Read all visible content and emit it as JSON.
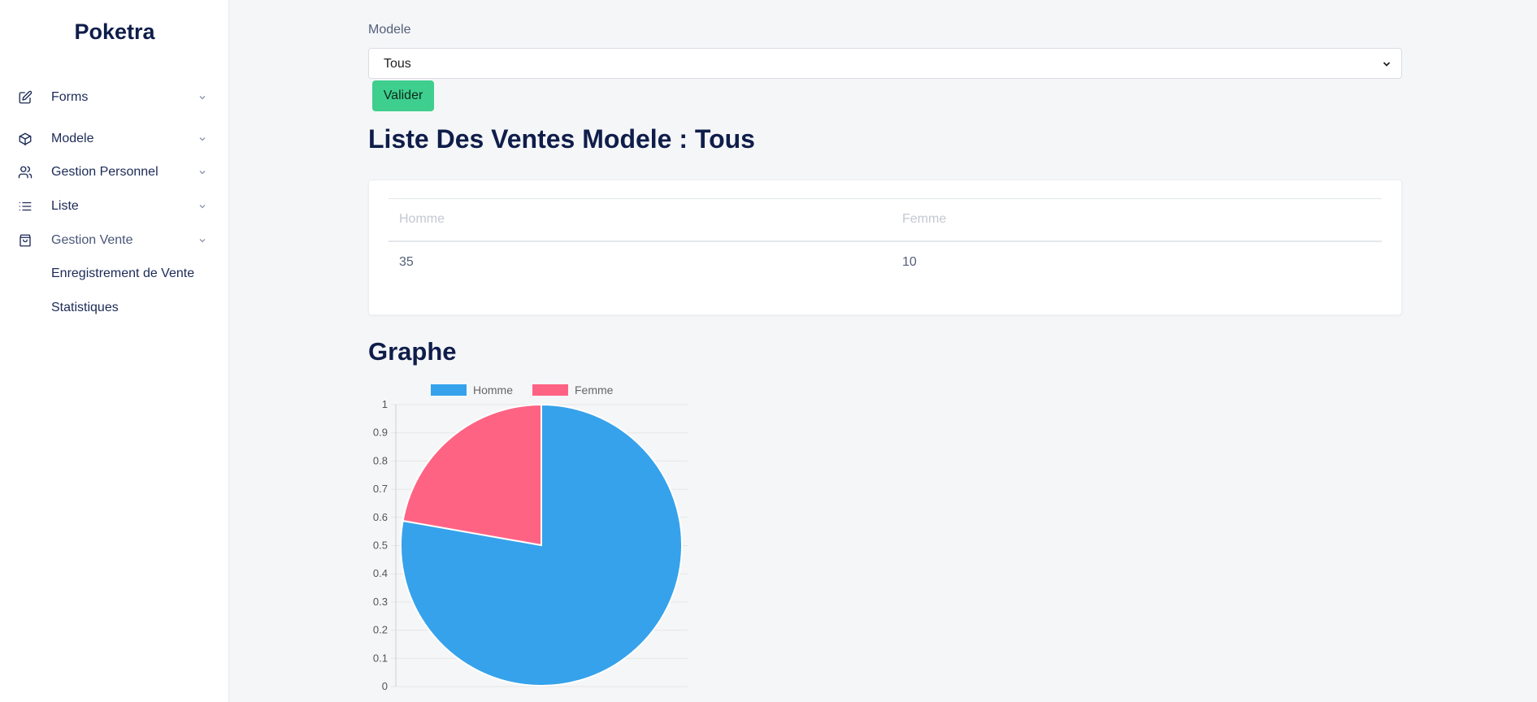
{
  "sidebar": {
    "brand": "Poketra",
    "items": [
      {
        "label": "Forms",
        "icon": "edit-icon"
      },
      {
        "label": "Modele",
        "icon": "box-icon"
      },
      {
        "label": "Gestion Personnel",
        "icon": "users-icon"
      },
      {
        "label": "Liste",
        "icon": "list-icon"
      },
      {
        "label": "Gestion Vente",
        "icon": "shopping-bag-icon"
      }
    ],
    "sub_items": [
      {
        "label": "Enregistrement de Vente"
      },
      {
        "label": "Statistiques"
      }
    ]
  },
  "filter": {
    "label": "Modele",
    "selected": "Tous",
    "button_label": "Valider"
  },
  "page_title": "Liste Des Ventes Modele : Tous",
  "table": {
    "headers": [
      "Homme",
      "Femme"
    ],
    "rows": [
      [
        "35",
        "10"
      ]
    ]
  },
  "graph_title": "Graphe",
  "colors": {
    "accent": "#3ecf8e",
    "homme": "#36a2eb",
    "femme": "#ff6384",
    "title": "#0f1d4a"
  },
  "chart_data": {
    "type": "pie",
    "labels": [
      "Homme",
      "Femme"
    ],
    "values": [
      35,
      10
    ],
    "colors": [
      "#36a2eb",
      "#ff6384"
    ],
    "legend": "top",
    "y_ticks": [
      "0",
      "0.1",
      "0.2",
      "0.3",
      "0.4",
      "0.5",
      "0.6",
      "0.7",
      "0.8",
      "0.9",
      "1"
    ],
    "ylim": [
      0,
      1
    ],
    "grid": true
  }
}
